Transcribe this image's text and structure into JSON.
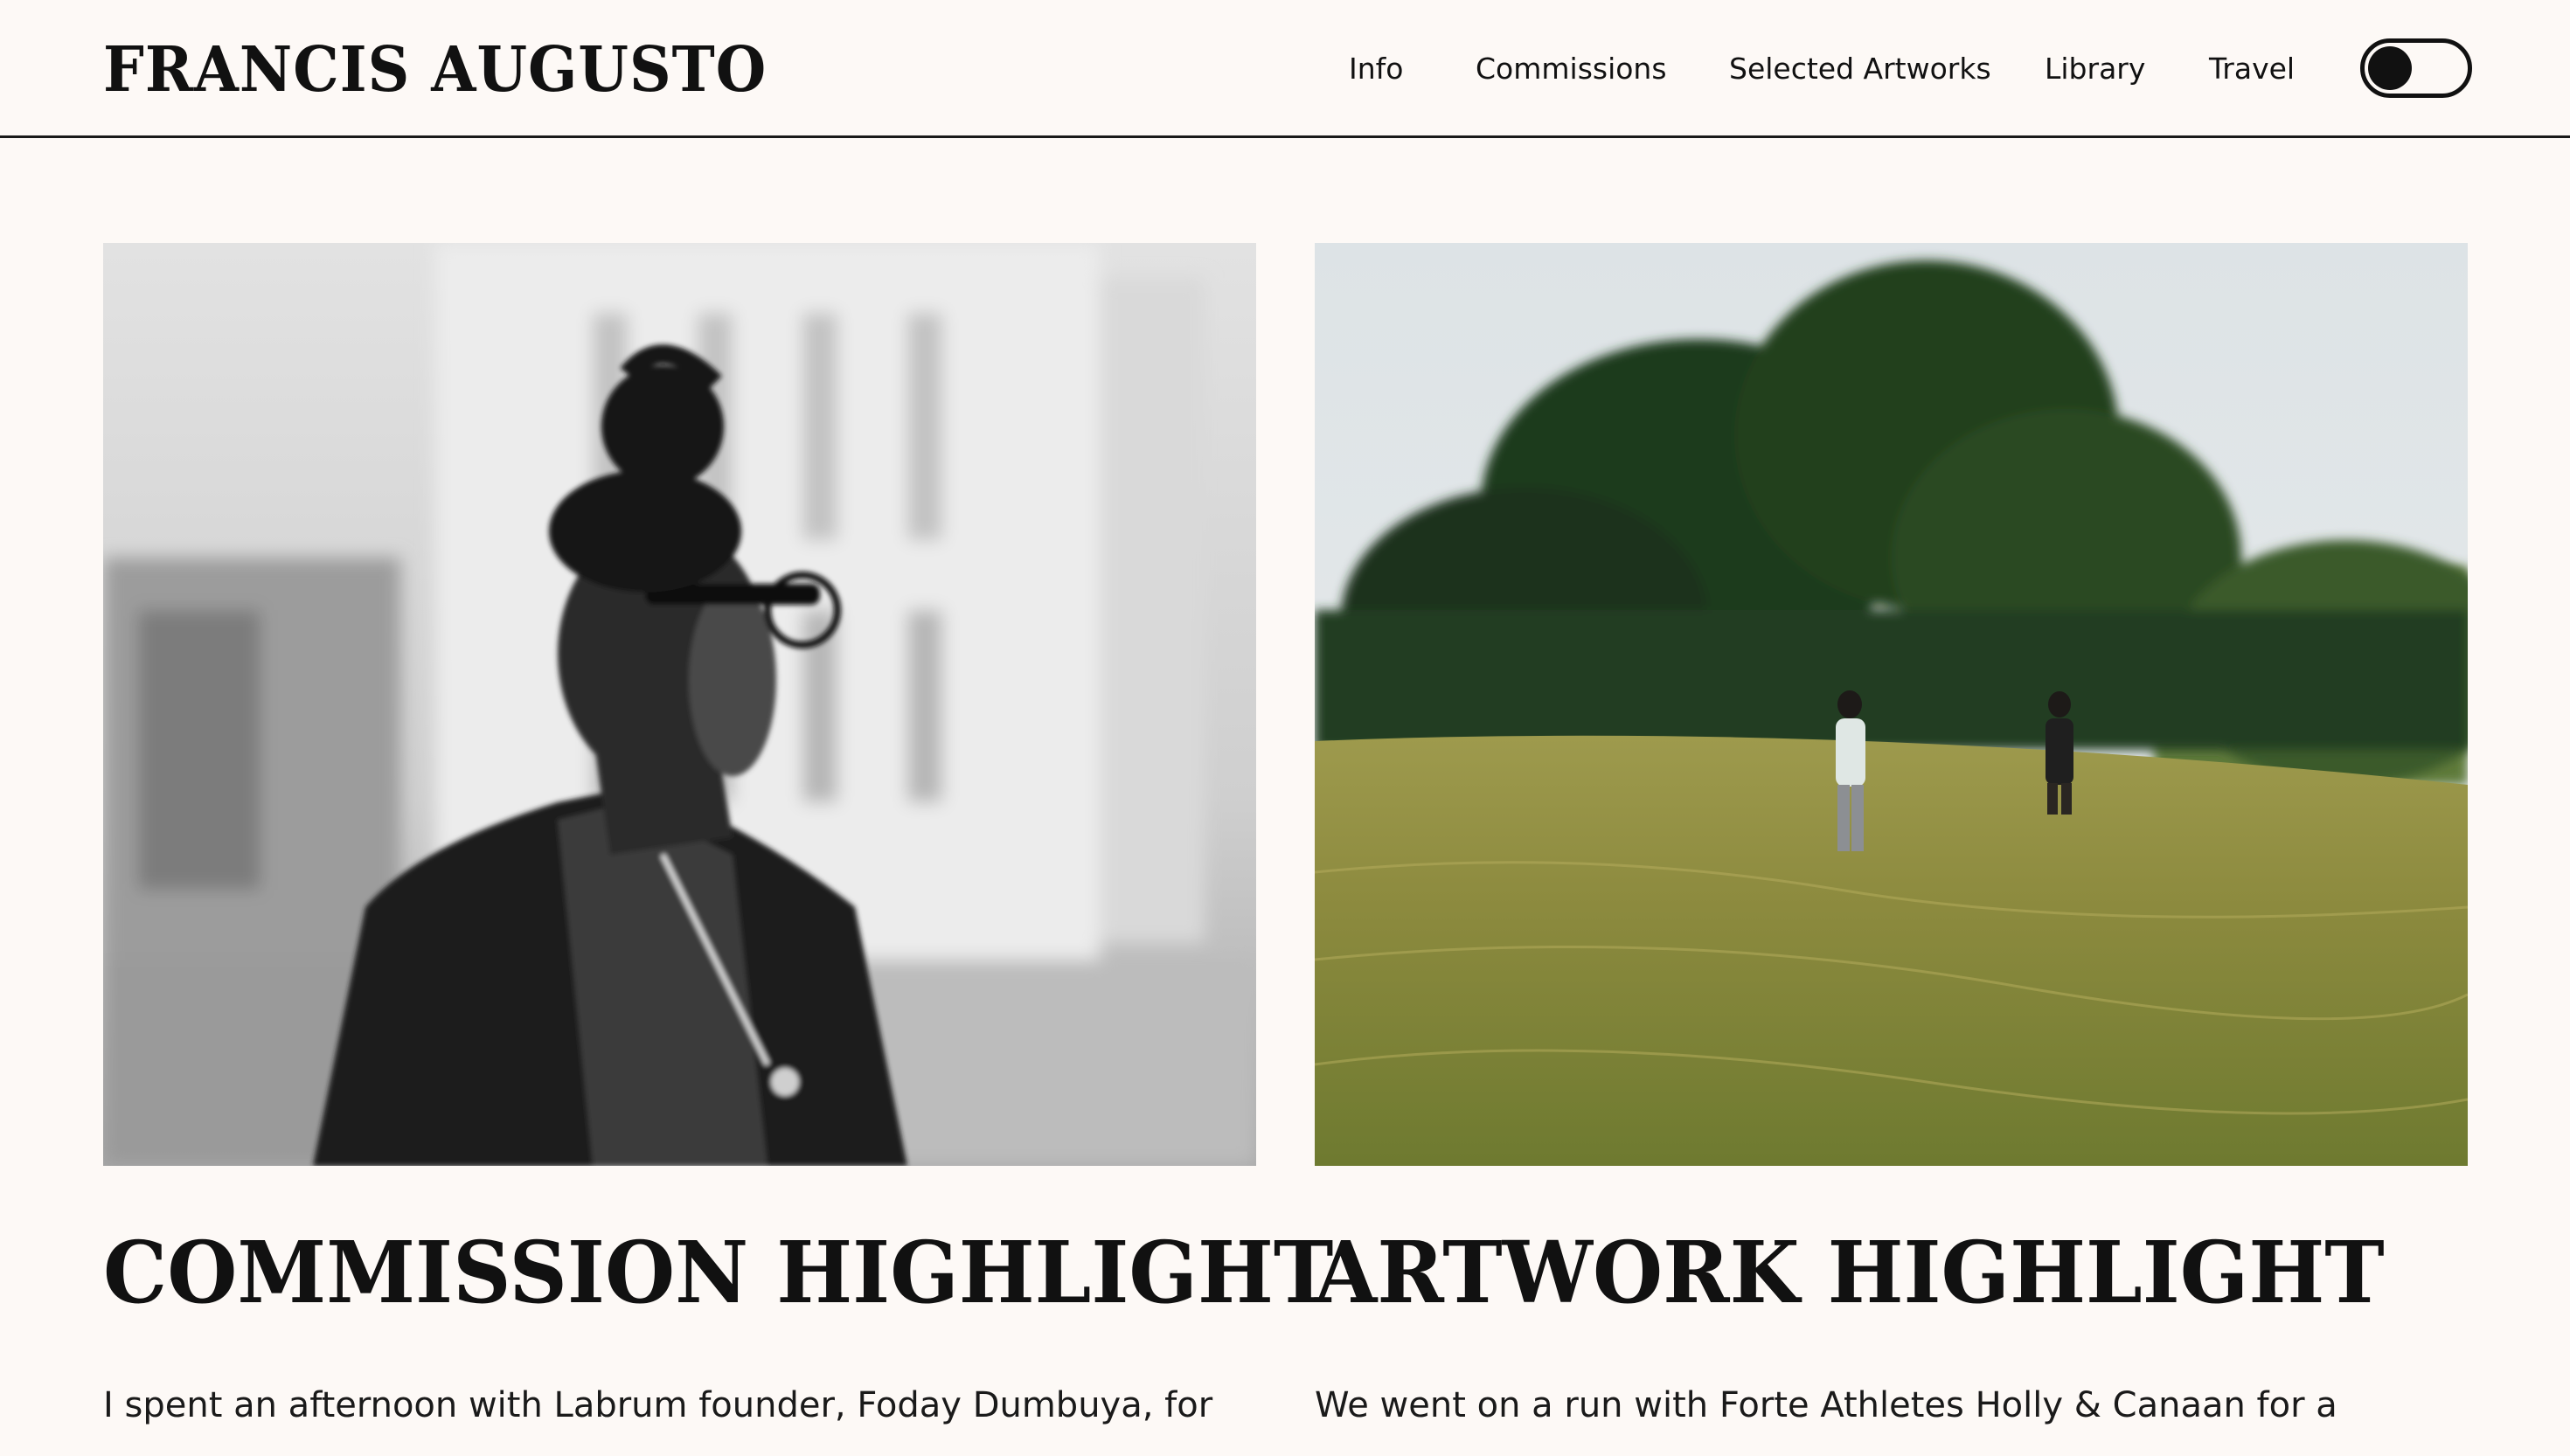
{
  "site": {
    "title": "FRANCIS AUGUSTO"
  },
  "nav": {
    "items": [
      {
        "label": "Info"
      },
      {
        "label": "Commissions"
      },
      {
        "label": "Selected Artworks"
      },
      {
        "label": "Library"
      },
      {
        "label": "Travel"
      }
    ],
    "theme_toggle": {
      "state": "dark-off",
      "icon": "toggle-switch-icon"
    }
  },
  "highlights": [
    {
      "heading": "COMMISSION HIGHLIGHT",
      "text": "I spent an afternoon with Labrum founder, Foday Dumbuya, for",
      "image": "black-and-white portrait photo"
    },
    {
      "heading": "ARTWORK HIGHLIGHT",
      "text": "We went on a run with Forte Athletes Holly & Canaan for a",
      "image": "meadow landscape photo with two runners"
    }
  ],
  "colors": {
    "background": "#fdf9f6",
    "text": "#111111",
    "rule": "#1a1a1a"
  }
}
